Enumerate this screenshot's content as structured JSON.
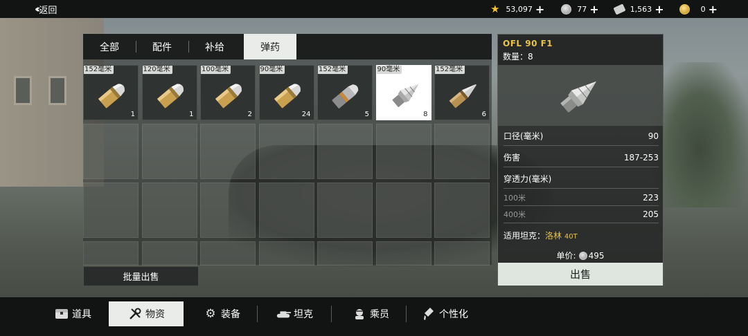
{
  "topbar": {
    "back_label": "返回",
    "currencies": [
      {
        "icon": "star-icon",
        "value": "53,097"
      },
      {
        "icon": "silver-coin-icon",
        "value": "77"
      },
      {
        "icon": "bond-icon",
        "value": "1,563"
      },
      {
        "icon": "gold-coin-icon",
        "value": "0"
      }
    ],
    "plus": "+"
  },
  "tabs": [
    "全部",
    "配件",
    "补给",
    "弹药"
  ],
  "active_tab": "弹药",
  "items": [
    {
      "caliber": "152毫米",
      "count": "1",
      "kind": "gold"
    },
    {
      "caliber": "120毫米",
      "count": "1",
      "kind": "gold"
    },
    {
      "caliber": "100毫米",
      "count": "2",
      "kind": "gold"
    },
    {
      "caliber": "90毫米",
      "count": "24",
      "kind": "gold"
    },
    {
      "caliber": "152毫米",
      "count": "5",
      "kind": "silver-band"
    },
    {
      "caliber": "90毫米",
      "count": "8",
      "kind": "spike",
      "selected": true
    },
    {
      "caliber": "152毫米",
      "count": "6",
      "kind": "long"
    }
  ],
  "bulk_sell_label": "批量出售",
  "detail": {
    "name": "OFL 90 F1",
    "qty_label": "数量：8",
    "caliber_label": "口径(毫米)",
    "caliber_value": "90",
    "damage_label": "伤害",
    "damage_value": "187-253",
    "penetration_label": "穿透力(毫米)",
    "pen_100_label": "100米",
    "pen_100_value": "223",
    "pen_400_label": "400米",
    "pen_400_value": "205",
    "tanks_label": "适用坦克：",
    "tank_name": "洛林",
    "tank_suffix": "40T",
    "price_label": "单价:",
    "price_value": "495",
    "sell_label": "出售"
  },
  "bottom_nav": [
    {
      "label": "道具",
      "icon": "chest-icon"
    },
    {
      "label": "物资",
      "icon": "tools-icon",
      "active": true
    },
    {
      "label": "装备",
      "icon": "gear-icon"
    },
    {
      "label": "坦克",
      "icon": "tank-icon"
    },
    {
      "label": "乘员",
      "icon": "crew-icon"
    },
    {
      "label": "个性化",
      "icon": "brush-icon"
    }
  ]
}
